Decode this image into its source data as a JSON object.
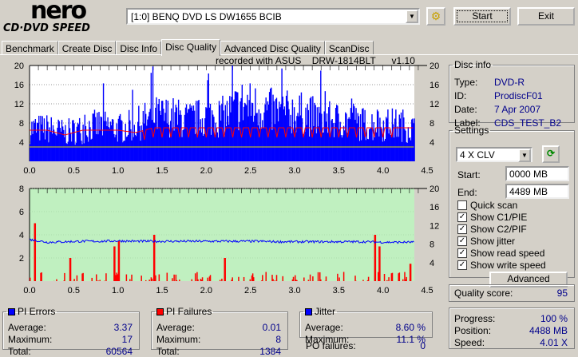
{
  "app": {
    "logo_top": "nero",
    "logo_bottom": "CD·DVD SPEED"
  },
  "toolbar": {
    "drive": "[1:0]  BENQ DVD LS DW1655 BCIB",
    "start": "Start",
    "exit": "Exit"
  },
  "tabs": [
    "Benchmark",
    "Create Disc",
    "Disc Info",
    "Disc Quality",
    "Advanced Disc Quality",
    "ScanDisc"
  ],
  "active_tab": "Disc Quality",
  "recorded_with": "recorded with ASUS    DRW-1814BLT      v1.10",
  "disc_info": {
    "title": "Disc info",
    "rows": [
      {
        "k": "Type:",
        "v": "DVD-R"
      },
      {
        "k": "ID:",
        "v": "ProdiscF01"
      },
      {
        "k": "Date:",
        "v": "7 Apr 2007"
      },
      {
        "k": "Label:",
        "v": "CDS_TEST_B2"
      }
    ]
  },
  "settings": {
    "title": "Settings",
    "speed": "4 X CLV",
    "start_label": "Start:",
    "start": "0000 MB",
    "end_label": "End:",
    "end": "4489 MB",
    "checks": [
      {
        "label": "Quick scan",
        "checked": false
      },
      {
        "label": "Show C1/PIE",
        "checked": true
      },
      {
        "label": "Show C2/PIF",
        "checked": true
      },
      {
        "label": "Show jitter",
        "checked": true
      },
      {
        "label": "Show read speed",
        "checked": true
      },
      {
        "label": "Show write speed",
        "checked": true
      }
    ],
    "advanced": "Advanced"
  },
  "quality": {
    "label": "Quality score:",
    "value": "95"
  },
  "progress": {
    "rows": [
      {
        "k": "Progress:",
        "v": "100 %"
      },
      {
        "k": "Position:",
        "v": "4488 MB"
      },
      {
        "k": "Speed:",
        "v": "4.01 X"
      }
    ]
  },
  "pi_errors": {
    "title": "PI Errors",
    "color": "#0000ff",
    "rows": [
      {
        "k": "Average:",
        "v": "3.37"
      },
      {
        "k": "Maximum:",
        "v": "17"
      },
      {
        "k": "Total:",
        "v": "60564"
      }
    ]
  },
  "pi_failures": {
    "title": "PI Failures",
    "color": "#ff0000",
    "rows": [
      {
        "k": "Average:",
        "v": "0.01"
      },
      {
        "k": "Maximum:",
        "v": "8"
      },
      {
        "k": "Total:",
        "v": "1384"
      }
    ]
  },
  "jitter": {
    "title": "Jitter",
    "color": "#0000ff",
    "rows": [
      {
        "k": "Average:",
        "v": "8.60 %"
      },
      {
        "k": "Maximum:",
        "v": "11.1 %"
      }
    ],
    "po_label": "PO failures:",
    "po_value": "0"
  },
  "chart_data": [
    {
      "type": "bar",
      "name": "PI errors",
      "x_ticks": [
        "0.0",
        "0.5",
        "1.0",
        "1.5",
        "2.0",
        "2.5",
        "3.0",
        "3.5",
        "4.0",
        "4.5"
      ],
      "y_left_ticks": [
        "20",
        "16",
        "12",
        "8",
        "4"
      ],
      "y_right_ticks": [
        "20",
        "16",
        "12",
        "8",
        "4"
      ],
      "xlim": [
        0,
        4.5
      ],
      "ylim": [
        0,
        20
      ],
      "x": [
        0.0,
        0.2,
        0.4,
        0.6,
        0.8,
        1.0,
        1.2,
        1.4,
        1.6,
        1.8,
        2.0,
        2.2,
        2.4,
        2.6,
        2.8,
        3.0,
        3.2,
        3.4,
        3.6,
        3.8,
        4.0,
        4.2,
        4.35
      ],
      "values": [
        8,
        8,
        7,
        8,
        9,
        8,
        9,
        11,
        11,
        10,
        11,
        11,
        14,
        13,
        12,
        12,
        11,
        10,
        10,
        9,
        9,
        9,
        8
      ],
      "read_speed": [
        6.5,
        6.5,
        5.5,
        6.5,
        6.5,
        6.5,
        6,
        7,
        7,
        7,
        7,
        7,
        7,
        7,
        7,
        7,
        7,
        7,
        7,
        7,
        7,
        7,
        7
      ]
    },
    {
      "type": "bar",
      "name": "PI failures",
      "x_ticks": [
        "0.0",
        "0.5",
        "1.0",
        "1.5",
        "2.0",
        "2.5",
        "3.0",
        "3.5",
        "4.0",
        "4.5"
      ],
      "y_left_ticks": [
        "8",
        "6",
        "4",
        "2"
      ],
      "y_right_ticks": [
        "20",
        "16",
        "12",
        "8",
        "4"
      ],
      "xlim": [
        0,
        4.5
      ],
      "ylim": [
        0,
        8
      ],
      "failure_spikes": [
        {
          "x": 0.05,
          "v": 5
        },
        {
          "x": 0.45,
          "v": 2
        },
        {
          "x": 0.95,
          "v": 3
        },
        {
          "x": 1.0,
          "v": 3.5
        },
        {
          "x": 1.4,
          "v": 4
        },
        {
          "x": 2.2,
          "v": 2
        },
        {
          "x": 3.9,
          "v": 4
        },
        {
          "x": 3.95,
          "v": 3
        },
        {
          "x": 4.3,
          "v": 1.5
        }
      ],
      "jitter_percent": [
        9,
        8.4,
        8.5,
        8.6,
        8.6,
        8.7,
        8.6,
        8.6,
        8.6,
        8.6,
        8.6,
        8.6,
        8.6,
        8.6,
        8.5,
        8.5,
        8.5,
        8.5,
        8.5,
        8.5,
        8.4,
        8.4,
        8.4
      ]
    }
  ]
}
